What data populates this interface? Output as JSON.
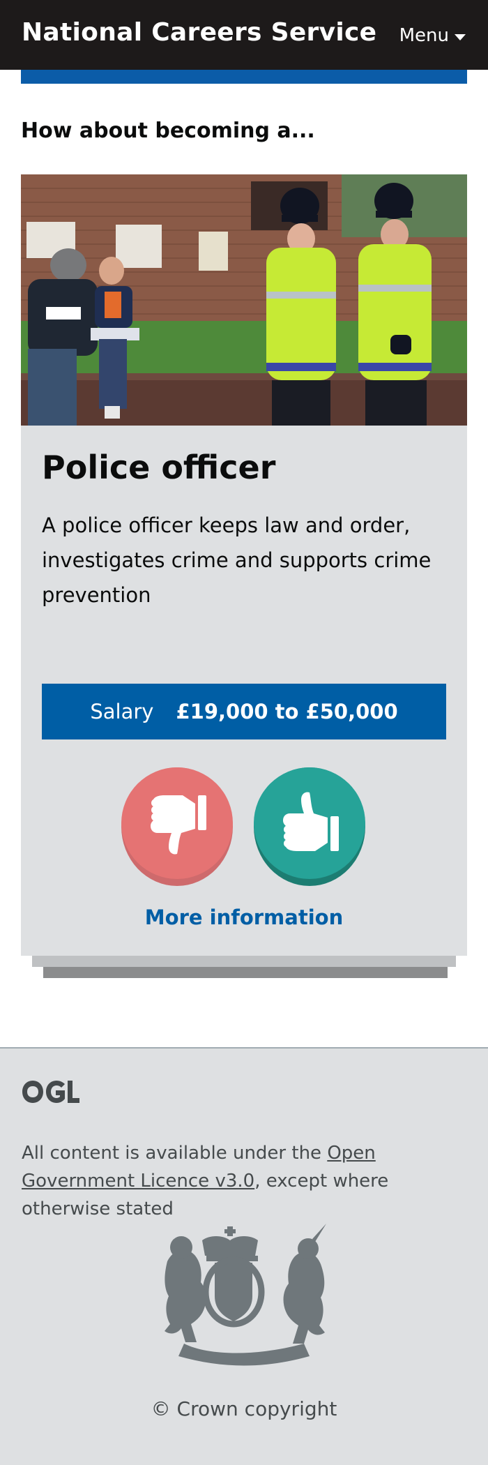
{
  "header": {
    "title": "National Careers Service",
    "menu_label": "Menu"
  },
  "main": {
    "intro": "How about becoming a...",
    "job": {
      "title": "Police officer",
      "description": "A police officer keeps law and order, investigates crime and supports crime prevention",
      "salary_label": "Salary",
      "salary_value": "£19,000 to £50,000",
      "more_info_label": "More information"
    }
  },
  "footer": {
    "licence_prefix": "All content is available under the ",
    "licence_link": "Open Government Licence v3.0",
    "licence_suffix": ", except where otherwise stated",
    "copyright": "© Crown copyright"
  },
  "colors": {
    "header_bg": "#1d1a1a",
    "accent_blue": "#005ea5",
    "card_bg": "#dee0e2",
    "dislike": "#e57373",
    "like": "#26a398"
  },
  "icons": [
    "ogl-logo-icon",
    "royal-coat-of-arms-icon",
    "thumbs-down-icon",
    "thumbs-up-icon",
    "chevron-down-icon"
  ]
}
